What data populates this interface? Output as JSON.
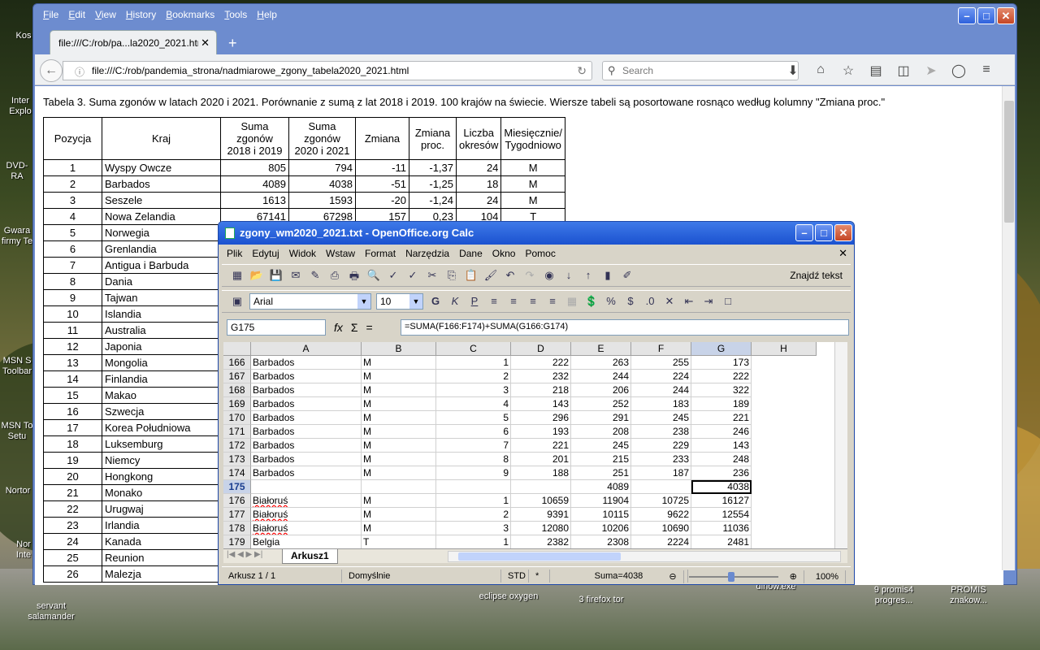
{
  "firefox": {
    "menu": [
      "File",
      "Edit",
      "View",
      "History",
      "Bookmarks",
      "Tools",
      "Help"
    ],
    "tab_title": "file:///C:/rob/pa...la2020_2021.html",
    "url": "file:///C:/rob/pandemia_strona/nadmiarowe_zgony_tabela2020_2021.html",
    "search_placeholder": "Search",
    "caption": "Tabela 3. Suma zgonów w latach 2020 i 2021. Porównanie z sumą z lat 2018 i 2019. 100 krajów na świecie. Wiersze tabeli są posortowane rosnąco według kolumny \"Zmiana proc.\"",
    "table": {
      "headers": [
        "Pozycja",
        "Kraj",
        "Suma zgonów 2018 i 2019",
        "Suma zgonów 2020 i 2021",
        "Zmiana",
        "Zmiana proc.",
        "Liczba okresów",
        "Miesięcznie/ Tygodniowo"
      ],
      "rows": [
        [
          "1",
          "Wyspy Owcze",
          "805",
          "794",
          "-11",
          "-1,37",
          "24",
          "M"
        ],
        [
          "2",
          "Barbados",
          "4089",
          "4038",
          "-51",
          "-1,25",
          "18",
          "M"
        ],
        [
          "3",
          "Seszele",
          "1613",
          "1593",
          "-20",
          "-1,24",
          "24",
          "M"
        ],
        [
          "4",
          "Nowa Zelandia",
          "67141",
          "67298",
          "157",
          "0,23",
          "104",
          "T"
        ],
        [
          "5",
          "Norwegia"
        ],
        [
          "6",
          "Grenlandia"
        ],
        [
          "7",
          "Antigua i Barbuda"
        ],
        [
          "8",
          "Dania"
        ],
        [
          "9",
          "Tajwan"
        ],
        [
          "10",
          "Islandia"
        ],
        [
          "11",
          "Australia"
        ],
        [
          "12",
          "Japonia"
        ],
        [
          "13",
          "Mongolia"
        ],
        [
          "14",
          "Finlandia"
        ],
        [
          "15",
          "Makao"
        ],
        [
          "16",
          "Szwecja"
        ],
        [
          "17",
          "Korea Południowa"
        ],
        [
          "18",
          "Luksemburg"
        ],
        [
          "19",
          "Niemcy"
        ],
        [
          "20",
          "Hongkong"
        ],
        [
          "21",
          "Monako"
        ],
        [
          "22",
          "Urugwaj"
        ],
        [
          "23",
          "Irlandia"
        ],
        [
          "24",
          "Kanada"
        ],
        [
          "25",
          "Reunion"
        ],
        [
          "26",
          "Malezja"
        ]
      ]
    }
  },
  "calc": {
    "title": "zgony_wm2020_2021.txt - OpenOffice.org Calc",
    "menu": [
      "Plik",
      "Edytuj",
      "Widok",
      "Wstaw",
      "Format",
      "Narzędzia",
      "Dane",
      "Okno",
      "Pomoc"
    ],
    "find_text": "Znajdź tekst",
    "font_name": "Arial",
    "font_size": "10",
    "cell_ref": "G175",
    "formula": "=SUMA(F166:F174)+SUMA(G166:G174)",
    "columns": [
      "A",
      "B",
      "C",
      "D",
      "E",
      "F",
      "G",
      "H"
    ],
    "rows": [
      [
        "166",
        "Barbados",
        "M",
        "1",
        "222",
        "263",
        "255",
        "173"
      ],
      [
        "167",
        "Barbados",
        "M",
        "2",
        "232",
        "244",
        "224",
        "222"
      ],
      [
        "168",
        "Barbados",
        "M",
        "3",
        "218",
        "206",
        "244",
        "322"
      ],
      [
        "169",
        "Barbados",
        "M",
        "4",
        "143",
        "252",
        "183",
        "189"
      ],
      [
        "170",
        "Barbados",
        "M",
        "5",
        "296",
        "291",
        "245",
        "221"
      ],
      [
        "171",
        "Barbados",
        "M",
        "6",
        "193",
        "208",
        "238",
        "246"
      ],
      [
        "172",
        "Barbados",
        "M",
        "7",
        "221",
        "245",
        "229",
        "143"
      ],
      [
        "173",
        "Barbados",
        "M",
        "8",
        "201",
        "215",
        "233",
        "248"
      ],
      [
        "174",
        "Barbados",
        "M",
        "9",
        "188",
        "251",
        "187",
        "236"
      ],
      [
        "175",
        "",
        "",
        "",
        "",
        "4089",
        "",
        "4038"
      ],
      [
        "176",
        "Białoruś",
        "M",
        "1",
        "10659",
        "11904",
        "10725",
        "16127"
      ],
      [
        "177",
        "Białoruś",
        "M",
        "2",
        "9391",
        "10115",
        "9622",
        "12554"
      ],
      [
        "178",
        "Białoruś",
        "M",
        "3",
        "12080",
        "10206",
        "10690",
        "11036"
      ],
      [
        "179",
        "Belgia",
        "T",
        "1",
        "2382",
        "2308",
        "2224",
        "2481"
      ]
    ],
    "sheet_tab": "Arkusz1",
    "status": {
      "sheet": "Arkusz 1 / 1",
      "style": "Domyślnie",
      "mode": "STD",
      "mod": "*",
      "sum": "Suma=4038",
      "zoom": "100%"
    }
  },
  "desktop": {
    "labels": [
      "Kos",
      "Inter Explo",
      "DVD-RA",
      "Gwara firmy Te",
      "MSN S Toolbar",
      "MSN To Setu",
      "Nortor",
      "Nor Inte",
      "servant salamander",
      "eclipse oxygen",
      "3 firefox tor",
      "dinow.exe",
      "9 promis4 progres...",
      "PROMIS znakow..."
    ]
  }
}
